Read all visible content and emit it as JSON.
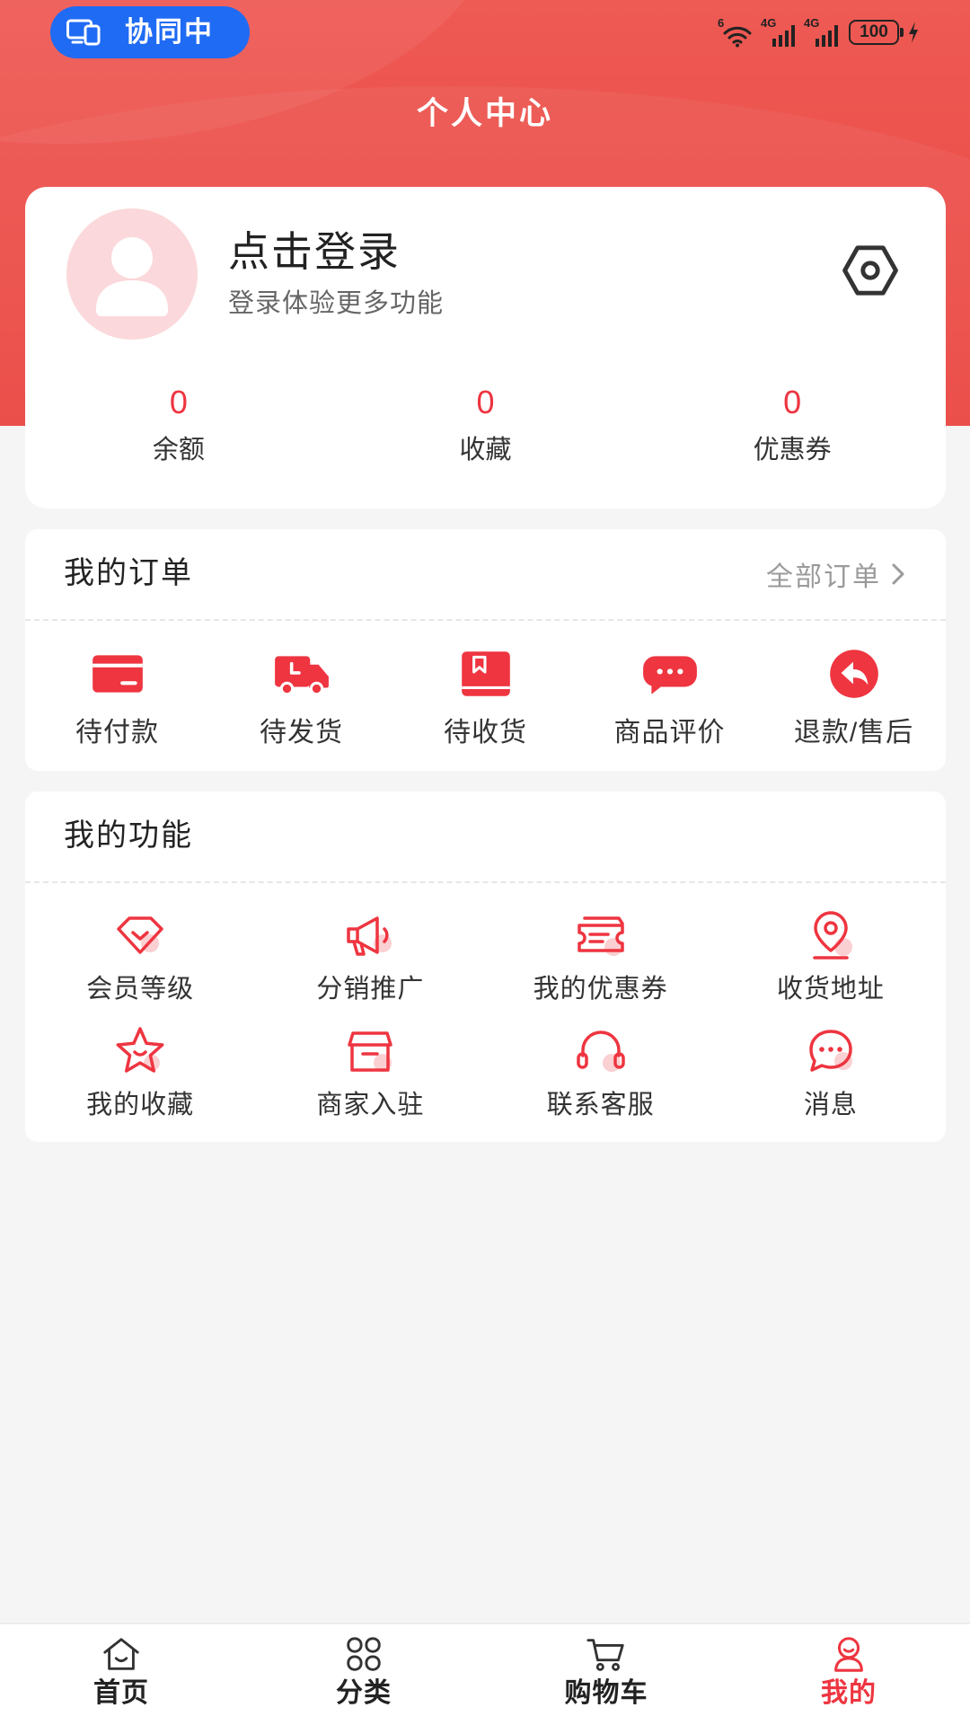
{
  "status_bar": {
    "collab_label": "协同中",
    "wifi_label": "6",
    "network_1": "4G",
    "network_2": "4G",
    "battery": "100"
  },
  "page": {
    "title": "个人中心"
  },
  "profile": {
    "login_label": "点击登录",
    "subtitle": "登录体验更多功能",
    "settings_icon": "settings-icon",
    "stats": [
      {
        "value": "0",
        "label": "余额"
      },
      {
        "value": "0",
        "label": "收藏"
      },
      {
        "value": "0",
        "label": "优惠券"
      }
    ]
  },
  "orders": {
    "title": "我的订单",
    "all_label": "全部订单",
    "items": [
      {
        "label": "待付款",
        "icon": "card-icon"
      },
      {
        "label": "待发货",
        "icon": "truck-icon"
      },
      {
        "label": "待收货",
        "icon": "package-icon"
      },
      {
        "label": "商品评价",
        "icon": "comment-icon"
      },
      {
        "label": "退款/售后",
        "icon": "return-icon"
      }
    ]
  },
  "functions": {
    "title": "我的功能",
    "items": [
      {
        "label": "会员等级",
        "icon": "gem-icon"
      },
      {
        "label": "分销推广",
        "icon": "megaphone-icon"
      },
      {
        "label": "我的优惠券",
        "icon": "coupon-icon"
      },
      {
        "label": "收货地址",
        "icon": "location-icon"
      },
      {
        "label": "我的收藏",
        "icon": "star-icon"
      },
      {
        "label": "商家入驻",
        "icon": "shop-icon"
      },
      {
        "label": "联系客服",
        "icon": "headset-icon"
      },
      {
        "label": "消息",
        "icon": "message-icon"
      }
    ]
  },
  "tab_bar": {
    "items": [
      {
        "label": "首页",
        "icon": "home-icon",
        "active": false
      },
      {
        "label": "分类",
        "icon": "grid-icon",
        "active": false
      },
      {
        "label": "购物车",
        "icon": "cart-icon",
        "active": false
      },
      {
        "label": "我的",
        "icon": "user-icon",
        "active": true
      }
    ]
  },
  "colors": {
    "accent": "#EE3540",
    "header_red": "#EA4641",
    "collab_pill": "#1F6BF4",
    "icon_pink": "#FBD0D3",
    "page_background": "#F5F5F5"
  }
}
